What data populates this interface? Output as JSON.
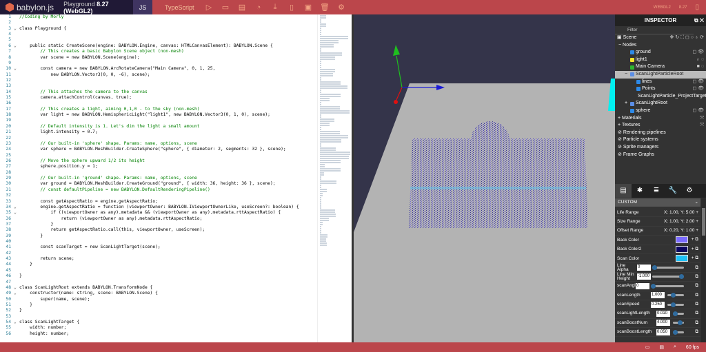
{
  "header": {
    "brand": "babylon.js",
    "playground_prefix": "Playground",
    "version": "8.27",
    "api": "(WebGL2)",
    "tab_js": "JS",
    "tab_ts": "TypeScript",
    "engine": "WEBGL2",
    "engine_version": "8.27"
  },
  "code": {
    "lines": [
      "//Coding by Morly",
      "",
      "class Playground {",
      "",
      "",
      "    public static CreateScene(engine: BABYLON.Engine, canvas: HTMLCanvasElement): BABYLON.Scene {",
      "        // This creates a basic Babylon Scene object (non-mesh)",
      "        var scene = new BABYLON.Scene(engine);",
      "",
      "        const camera = new BABYLON.ArcRotateCamera(\"Main Camera\", 0, 1, 25,",
      "            new BABYLON.Vector3(0, 0, -6), scene);",
      "",
      "",
      "        // This attaches the camera to the canvas",
      "        camera.attachControl(canvas, true);",
      "",
      "        // This creates a light, aiming 0,1,0 - to the sky (non-mesh)",
      "        var light = new BABYLON.HemisphericLight(\"light1\", new BABYLON.Vector3(0, 1, 0), scene);",
      "",
      "        // Default intensity is 1. Let's dim the light a small amount",
      "        light.intensity = 0.7;",
      "",
      "        // Our built-in 'sphere' shape. Params: name, options, scene",
      "        var sphere = BABYLON.MeshBuilder.CreateSphere(\"sphere\", { diameter: 2, segments: 32 }, scene);",
      "",
      "        // Move the sphere upward 1/2 its height",
      "        sphere.position.y = 1;",
      "",
      "        // Our built-in 'ground' shape. Params: name, options, scene",
      "        var ground = BABYLON.MeshBuilder.CreateGround(\"ground\", { width: 36, height: 36 }, scene);",
      "        // const defaultPipeline = new BABYLON.DefaultRenderingPipeline()",
      "",
      "        const getAspectRatio = engine.getAspectRatio;",
      "        engine.getAspectRatio = function (viewportOwner: BABYLON.IViewportOwnerLike, useScreen?: boolean) {",
      "            if ((viewportOwner as any).metadata && (viewportOwner as any).metadata.rttAspectRatio) {",
      "                return (viewportOwner as any).metadata.rttAspectRatio;",
      "            }",
      "            return getAspectRatio.call(this, viewportOwner, useScreen);",
      "        }",
      "",
      "        const scanTarget = new ScanLightTarget(scene);",
      "",
      "        return scene;",
      "    }",
      "",
      "}",
      "",
      "class ScanLightRoot extends BABYLON.TransformNode {",
      "    constructor(name: string, scene: BABYLON.Scene) {",
      "        super(name, scene);",
      "    }",
      "}",
      "",
      "class ScanLightTarget {",
      "    width: number;",
      "    height: number;"
    ]
  },
  "inspector": {
    "title": "INSPECTOR",
    "filter": "Filter",
    "scene": "Scene",
    "nodes": "Nodes",
    "tree": [
      {
        "label": "ground",
        "color": "#2d8ae8"
      },
      {
        "label": "light1",
        "color": "#f5e52a"
      },
      {
        "label": "Main Camera",
        "color": "#2fb52f"
      },
      {
        "label": "ScanLightParticleRoot",
        "color": "#5b8ee6"
      },
      {
        "label": "lines",
        "color": "#2d8ae8"
      },
      {
        "label": "Points",
        "color": "#2d8ae8"
      },
      {
        "label": "ScanLightParticle_ProjectTarget",
        "color": "#5b8ee6"
      },
      {
        "label": "ScanLightRoot",
        "color": "#5b8ee6"
      },
      {
        "label": "sphere",
        "color": "#2d8ae8"
      }
    ],
    "sections": [
      "Materials",
      "Textures"
    ],
    "disabled": [
      "Rendering pipelines",
      "Particle systems",
      "Sprite managers",
      "Frame Graphs"
    ],
    "custom": "CUSTOM",
    "ranges": [
      {
        "label": "Life Range",
        "value": "X: 1.00, Y: 5.00"
      },
      {
        "label": "Size Range",
        "value": "X: 1.00, Y: 2.00"
      },
      {
        "label": "Offset Range",
        "value": "X: 0.20, Y: 1.00"
      }
    ],
    "colors": [
      {
        "label": "Back Color",
        "hex": "#7b6bff"
      },
      {
        "label": "Back Color2",
        "hex": "#0c0660"
      },
      {
        "label": "Scan Color",
        "hex": "#1ec0f5"
      }
    ],
    "sliders": [
      {
        "label": "Line Alpha",
        "value": "0",
        "fraction": 0.0
      },
      {
        "label": "Line Min Height",
        "value": "-1.000",
        "fraction": 1.0
      },
      {
        "label": "scanAngle",
        "value": "0",
        "fraction": 0.0
      },
      {
        "label": "scanLength",
        "value": "1.000",
        "fraction": 0.3
      },
      {
        "label": "scanSpeed",
        "value": "0.250",
        "fraction": 0.3
      },
      {
        "label": "scanLightLength",
        "value": "0.010",
        "fraction": 0.02
      },
      {
        "label": "scanBoostNum",
        "value": "4.000",
        "fraction": 0.8
      },
      {
        "label": "scanBoostLength",
        "value": "0.050",
        "fraction": 0.05
      }
    ]
  },
  "footer": {
    "fps": "60 fps"
  }
}
